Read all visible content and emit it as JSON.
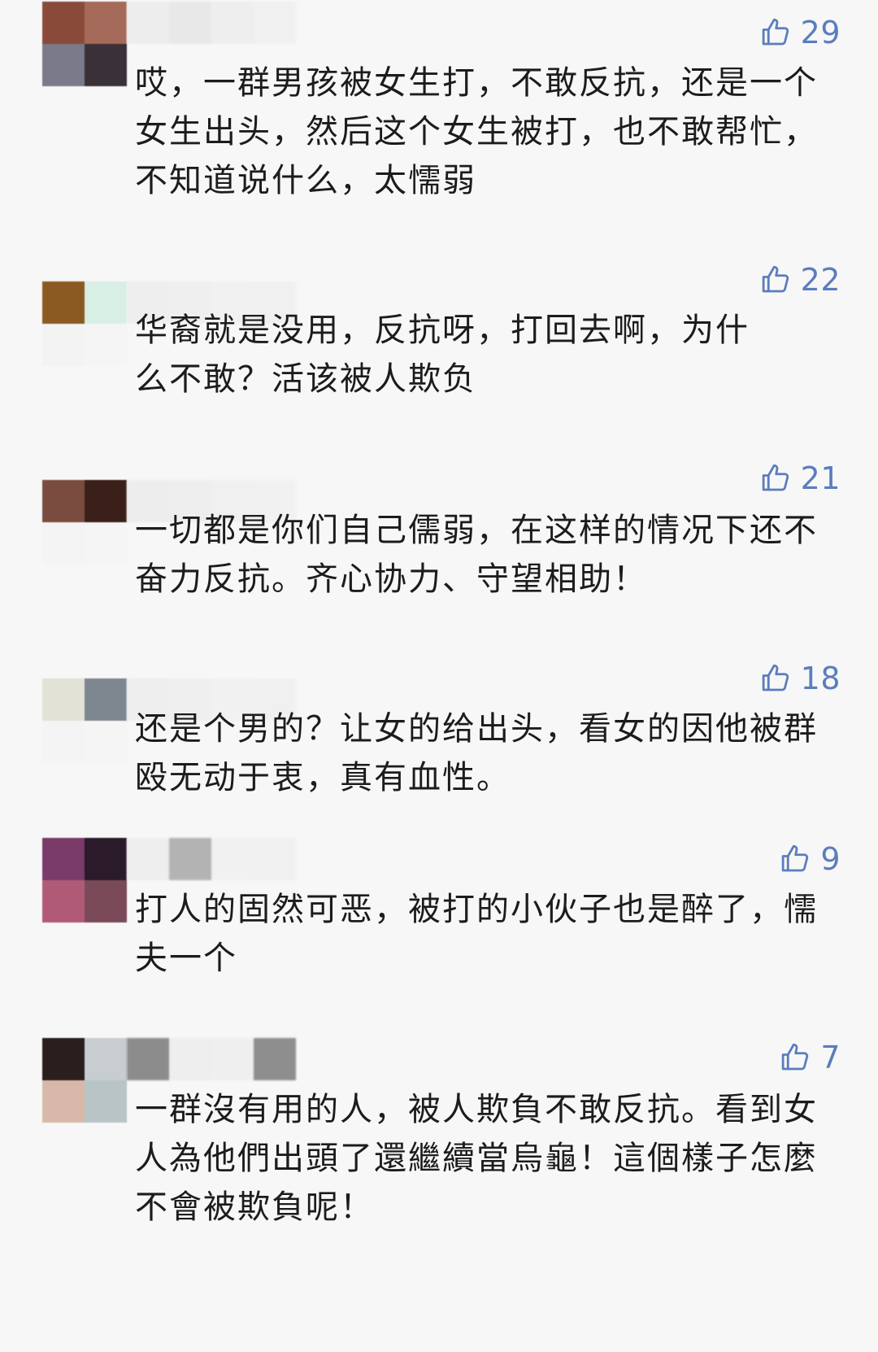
{
  "comments": [
    {
      "likes": "29",
      "text": "哎，一群男孩被女生打，不敢反抗，还是一个女生出头，然后这个女生被打，也不敢帮忙，不知道说什么，太懦弱",
      "avatar_colors": [
        "#8a4a3a",
        "#a66a5a",
        "#7a7a8a",
        "#3a3038"
      ],
      "nick_colors": [
        "#ececec",
        "#e6e6e6",
        "#ededed",
        "#efefef"
      ]
    },
    {
      "likes": "22",
      "text": "华裔就是没用，反抗呀，打回去啊，为什\n么不敢？活该被人欺负",
      "avatar_colors": [
        "#8b5a22",
        "#d8efe6",
        "#f3f3f3",
        "#f5f5f5"
      ],
      "nick_colors": [
        "#ededed",
        "#eeeeee",
        "#f0f0f0",
        "#efefef"
      ]
    },
    {
      "likes": "21",
      "text": "一切都是你们自己儒弱，在这样的情况下还不奋力反抗。齐心协力、守望相助！",
      "avatar_colors": [
        "#7a4c40",
        "#3a2018",
        "#f4f4f4",
        "#f5f5f5"
      ],
      "nick_colors": [
        "#ececec",
        "#ededed",
        "#efefef",
        "#f0f0f0"
      ]
    },
    {
      "likes": "18",
      "text": "还是个男的？让女的给出头，看女的因他被群殴无动于衷，真有血性。",
      "avatar_colors": [
        "#e2e2d6",
        "#7e8790",
        "#f4f4f4",
        "#f5f5f5"
      ],
      "nick_colors": [
        "#ededed",
        "#eeeeee",
        "#f0f0f0",
        "#efefef"
      ]
    },
    {
      "likes": "9",
      "text": "打人的固然可恶，被打的小伙子也是醉了，懦夫一个",
      "avatar_colors": [
        "#7a3a6a",
        "#2a1a2a",
        "#b05a78",
        "#7a4a58"
      ],
      "nick_colors": [
        "#ededed",
        "#a8a8a8",
        "#f0f0f0",
        "#efefef"
      ]
    },
    {
      "likes": "7",
      "text": "一群沒有用的人，被人欺負不敢反抗。看到女人為他們出頭了還繼續當烏龜！這個樣子怎麼不會被欺負呢！",
      "avatar_colors": [
        "#2a1e1e",
        "#c8cdd2",
        "#d8b8a8",
        "#b8c4c6"
      ],
      "nick_colors": [
        "#7a7a7a",
        "#ededed",
        "#eeeeee",
        "#7c7c7c"
      ]
    }
  ],
  "icons": {
    "like": "thumbs-up-icon"
  },
  "colors": {
    "like": "#5b7dbd",
    "background": "#f7f7f7",
    "text": "#1c1c1c"
  }
}
